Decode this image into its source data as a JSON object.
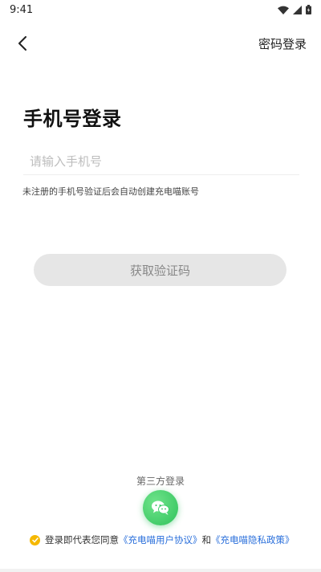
{
  "status_bar": {
    "time": "9:41",
    "icons": [
      "wifi-icon",
      "cellular-icon",
      "battery-icon"
    ]
  },
  "nav": {
    "back_icon": "chevron-left-icon",
    "right_link": "密码登录"
  },
  "title": "手机号登录",
  "phone_input": {
    "value": "",
    "placeholder": "请输入手机号"
  },
  "hint": "未注册的手机号验证后会自动创建充电喵账号",
  "get_code_button": "获取验证码",
  "third_party": {
    "label": "第三方登录",
    "wechat_icon": "wechat-icon"
  },
  "agreement": {
    "checked": true,
    "prefix": "登录即代表您同意",
    "user_agreement": "《充电喵用户协议》",
    "and": "和",
    "privacy_policy": "《充电喵隐私政策》"
  },
  "colors": {
    "accent_check": "#f5b800",
    "link": "#2a6fdb",
    "wechat_green": "#2fc25b",
    "disabled_button_bg": "#e6e6e6"
  }
}
